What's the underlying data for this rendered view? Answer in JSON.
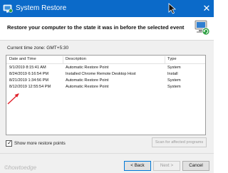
{
  "window": {
    "title": "System Restore",
    "close_glyph": "✕",
    "title_icon": "system-restore-icon"
  },
  "header": {
    "heading": "Restore your computer to the state it was in before the selected event",
    "icon": "system-restore-computer-icon"
  },
  "timezone": "Current time zone: GMT+5:30",
  "table": {
    "columns": [
      "Date and Time",
      "Description",
      "Type"
    ],
    "rows": [
      {
        "date": "9/1/2019 8:15:41 AM",
        "description": "Automatic Restore Point",
        "type": "System"
      },
      {
        "date": "8/24/2019 6:16:54 PM",
        "description": "Installed Chrome Remote Desktop Host",
        "type": "Install"
      },
      {
        "date": "8/21/2019 1:34:56 PM",
        "description": "Automatic Restore Point",
        "type": "System"
      },
      {
        "date": "8/12/2019 12:55:54 PM",
        "description": "Automatic Restore Point",
        "type": "System"
      }
    ]
  },
  "show_more": {
    "label": "Show more restore points",
    "checked": true,
    "check_glyph": "✓"
  },
  "scan_button": "Scan for affected programs",
  "buttons": {
    "back": "< Back",
    "next": "Next >",
    "cancel": "Cancel"
  },
  "watermark": "©howtoedge",
  "colors": {
    "titlebar": "#0b6ac9",
    "annotation_arrow": "#e0212b"
  }
}
